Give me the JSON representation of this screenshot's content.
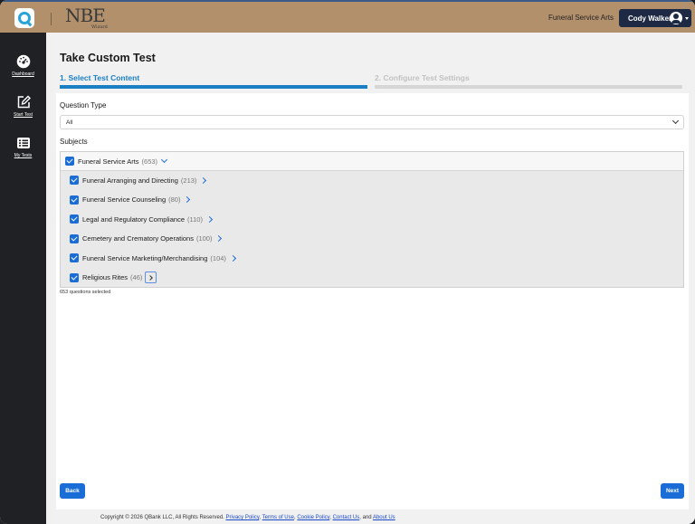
{
  "header": {
    "brand_main": "NBE",
    "brand_sub": "Wizard",
    "program": "Funeral Service Arts",
    "user_name": "Cody Walker"
  },
  "sidebar": {
    "items": [
      {
        "label": "Dashboard",
        "icon": "speedometer-icon"
      },
      {
        "label": "Start Test",
        "icon": "edit-icon"
      },
      {
        "label": "My Tests",
        "icon": "list-icon"
      }
    ]
  },
  "page": {
    "title": "Take Custom Test",
    "steps": [
      "1. Select Test Content",
      "2. Configure Test Settings"
    ],
    "active_step": 1
  },
  "form": {
    "question_type_label": "Question Type",
    "question_type_value": "All",
    "subjects_label": "Subjects",
    "root": {
      "name": "Funeral Service Arts",
      "count": "(653)",
      "checked": true
    },
    "subjects": [
      {
        "name": "Funeral Arranging and Directing",
        "count": "(213)",
        "checked": true
      },
      {
        "name": "Funeral Service Counseling",
        "count": "(80)",
        "checked": true
      },
      {
        "name": "Legal and Regulatory Compliance",
        "count": "(110)",
        "checked": true
      },
      {
        "name": "Cemetery and Crematory Operations",
        "count": "(100)",
        "checked": true
      },
      {
        "name": "Funeral Service Marketing/Merchandising",
        "count": "(104)",
        "checked": true
      },
      {
        "name": "Religious Rites",
        "count": "(46)",
        "checked": true
      }
    ],
    "selected_summary": "653 questions selected"
  },
  "buttons": {
    "back": "Back",
    "next": "Next"
  },
  "footer": {
    "copyright": "Copyright © 2026 QBank LLC, All Rights Reserved.",
    "links": [
      "Privacy Policy",
      "Terms of Use",
      "Cookie Policy",
      "Contact Us",
      "About Us"
    ],
    "sep": ",",
    "and": "and"
  },
  "colors": {
    "primary": "#1a6dd6",
    "header_bg": "#b2906c",
    "sidebar_bg": "#1f2125",
    "step_active": "#1b7fc4"
  }
}
